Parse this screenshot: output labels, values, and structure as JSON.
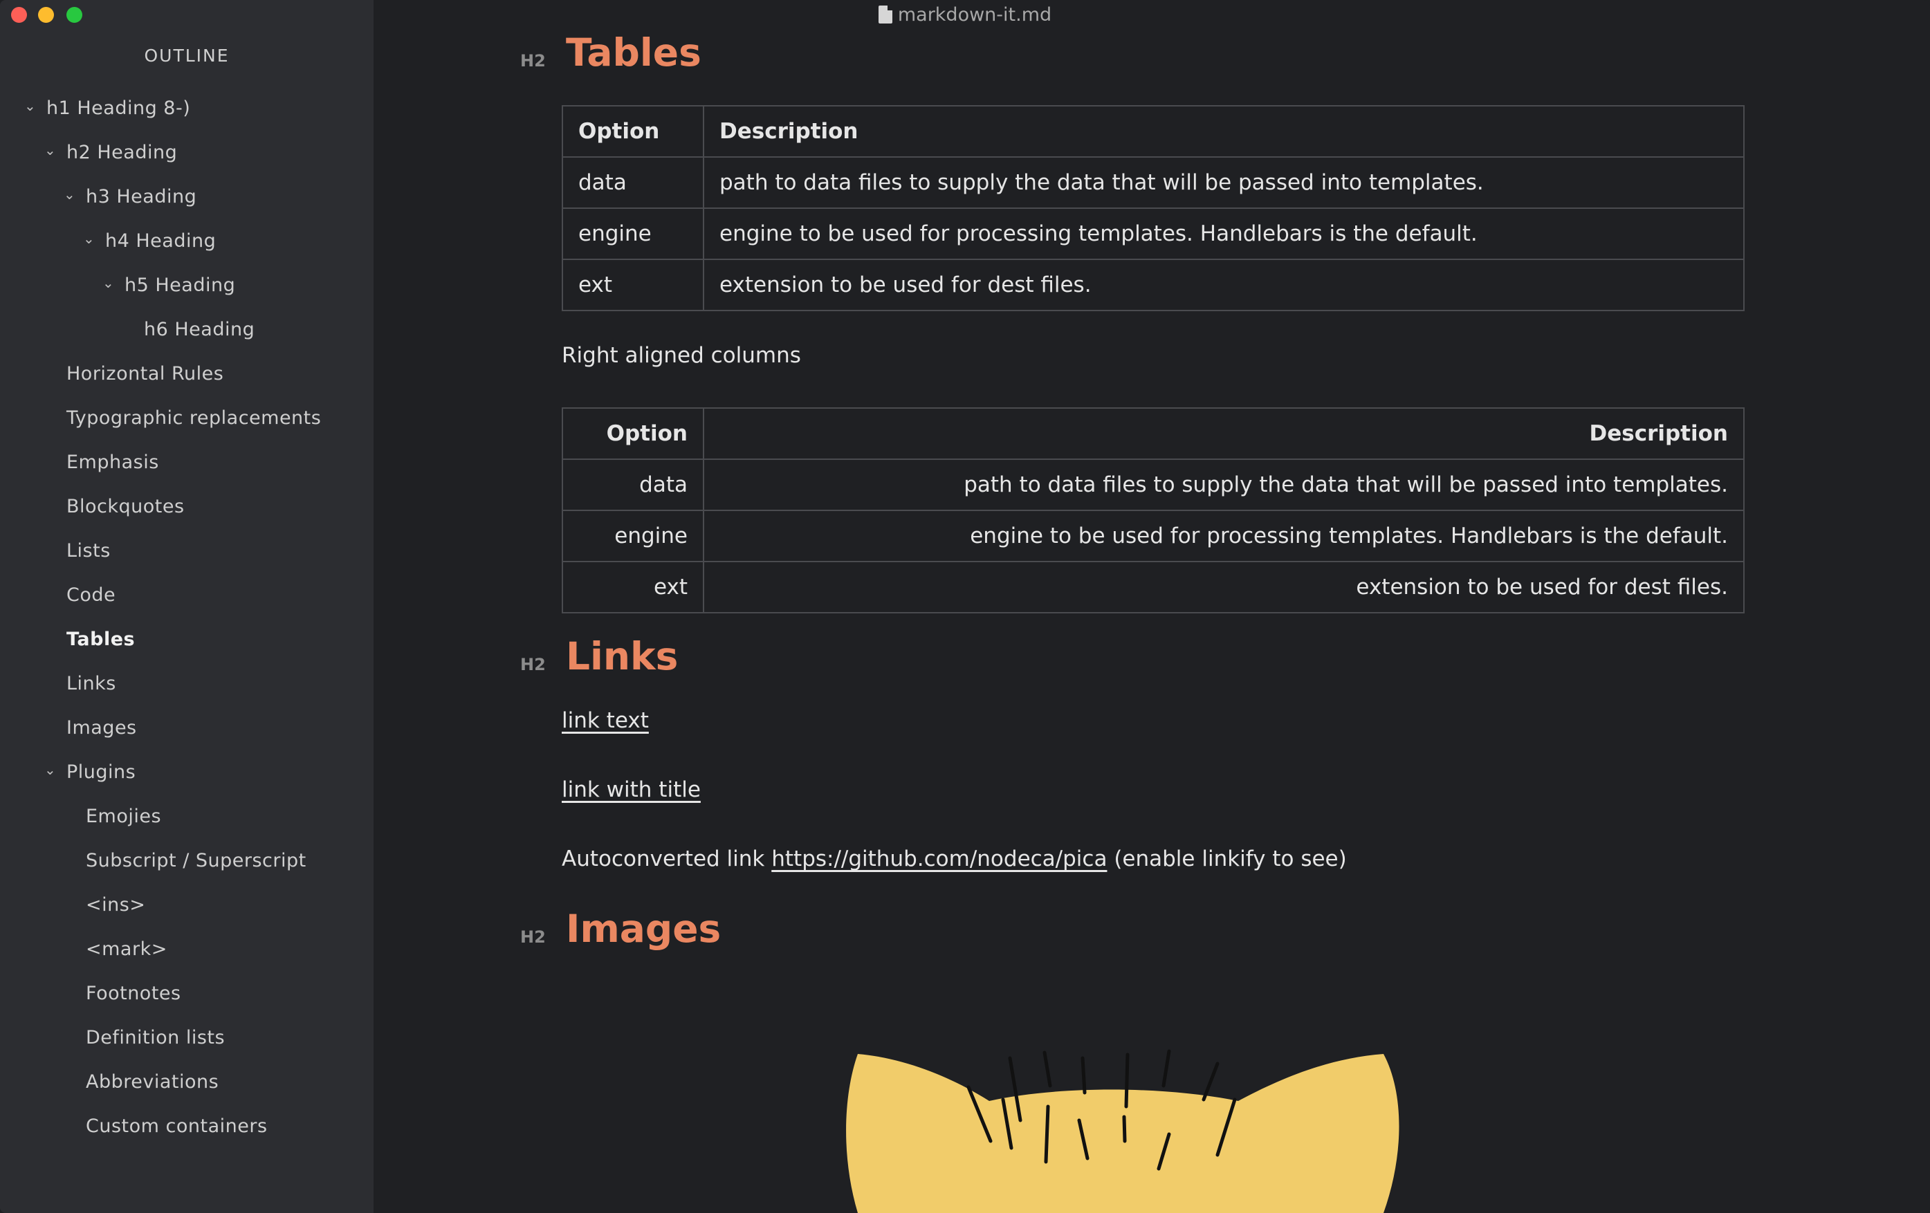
{
  "window": {
    "title": "markdown-it.md"
  },
  "sidebar": {
    "title": "OUTLINE",
    "items": [
      {
        "label": "h1 Heading 8-)",
        "collapsible": true
      },
      {
        "label": "h2 Heading",
        "collapsible": true
      },
      {
        "label": "h3 Heading",
        "collapsible": true
      },
      {
        "label": "h4 Heading",
        "collapsible": true
      },
      {
        "label": "h5 Heading",
        "collapsible": true
      },
      {
        "label": "h6 Heading",
        "collapsible": false
      },
      {
        "label": "Horizontal Rules",
        "collapsible": false
      },
      {
        "label": "Typographic replacements",
        "collapsible": false
      },
      {
        "label": "Emphasis",
        "collapsible": false
      },
      {
        "label": "Blockquotes",
        "collapsible": false
      },
      {
        "label": "Lists",
        "collapsible": false
      },
      {
        "label": "Code",
        "collapsible": false
      },
      {
        "label": "Tables",
        "collapsible": false,
        "active": true
      },
      {
        "label": "Links",
        "collapsible": false
      },
      {
        "label": "Images",
        "collapsible": false
      },
      {
        "label": "Plugins",
        "collapsible": true
      },
      {
        "label": "Emojies",
        "collapsible": false
      },
      {
        "label": "Subscript / Superscript",
        "collapsible": false
      },
      {
        "label": "<ins>",
        "collapsible": false
      },
      {
        "label": "<mark>",
        "collapsible": false
      },
      {
        "label": "Footnotes",
        "collapsible": false
      },
      {
        "label": "Definition lists",
        "collapsible": false
      },
      {
        "label": "Abbreviations",
        "collapsible": false
      },
      {
        "label": "Custom containers",
        "collapsible": false
      }
    ]
  },
  "content": {
    "h2_tag": "H2",
    "tables_heading": "Tables",
    "table1": {
      "headers": [
        "Option",
        "Description"
      ],
      "rows": [
        [
          "data",
          "path to data files to supply the data that will be passed into templates."
        ],
        [
          "engine",
          "engine to be used for processing templates. Handlebars is the default."
        ],
        [
          "ext",
          "extension to be used for dest files."
        ]
      ]
    },
    "right_aligned_label": "Right aligned columns",
    "table2": {
      "headers": [
        "Option",
        "Description"
      ],
      "rows": [
        [
          "data",
          "path to data files to supply the data that will be passed into templates."
        ],
        [
          "engine",
          "engine to be used for processing templates. Handlebars is the default."
        ],
        [
          "ext",
          "extension to be used for dest files."
        ]
      ]
    },
    "links_heading": "Links",
    "link_text": "link text",
    "link_with_title": "link with title",
    "autoconverted_prefix": "Autoconverted link ",
    "autoconverted_url": "https://github.com/nodeca/pica",
    "autoconverted_suffix": " (enable linkify to see)",
    "images_heading": "Images"
  },
  "colors": {
    "heading": "#ea8761",
    "sidebar_bg": "#2c2d31",
    "content_bg": "#1f2023",
    "cat": "#f1cc6a"
  }
}
